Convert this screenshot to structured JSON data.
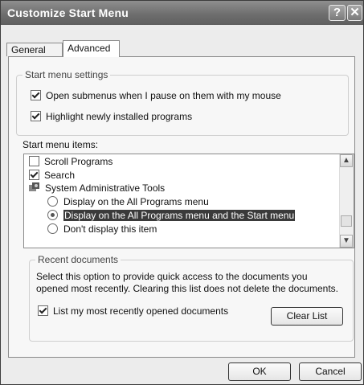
{
  "window": {
    "title": "Customize Start Menu"
  },
  "tabs": [
    {
      "label": "General"
    },
    {
      "label": "Advanced"
    }
  ],
  "start_menu_settings": {
    "label": "Start menu settings",
    "options": [
      {
        "label": "Open submenus when I pause on them with my mouse",
        "checked": true
      },
      {
        "label": "Highlight newly installed programs",
        "checked": true
      }
    ]
  },
  "start_menu_items": {
    "label": "Start menu items:",
    "items": [
      {
        "label": "Scroll Programs"
      },
      {
        "label": "Search"
      },
      {
        "label": "System Administrative Tools"
      },
      {
        "label": "Display on the All Programs menu"
      },
      {
        "label": "Display on the All Programs menu and the Start menu"
      },
      {
        "label": "Don't display this item"
      }
    ]
  },
  "recent_documents": {
    "label": "Recent documents",
    "description_line1": "Select this option to provide quick access to the documents you",
    "description_line2": "opened most recently.  Clearing this list does not delete the documents.",
    "checkbox_label": "List my most recently opened documents",
    "clear_label": "Clear List"
  },
  "buttons": {
    "ok": "OK",
    "cancel": "Cancel"
  },
  "colors": {
    "title_bar": "#6f6f6f",
    "selection": "#3a3a3a"
  }
}
